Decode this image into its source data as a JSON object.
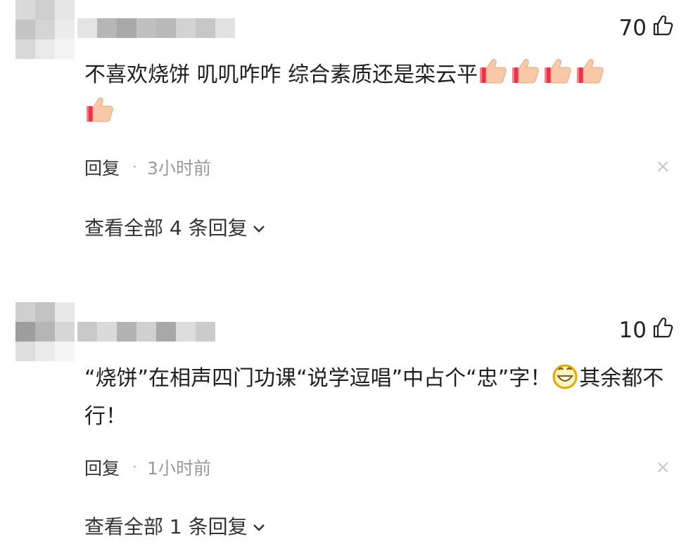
{
  "comments": [
    {
      "likes": "70",
      "text": "不喜欢烧饼 叽叽咋咋 综合素质还是栾云平",
      "thumbs_emoji_count": 5,
      "reply_label": "回复",
      "separator": "·",
      "time": "3小时前",
      "close_symbol": "×",
      "view_replies": "查看全部 4 条回复"
    },
    {
      "likes": "10",
      "text_part1": "“烧饼”在相声四门功课“说学逗唱”中占个“忠”字！",
      "text_part2": "其余都不行！",
      "reply_label": "回复",
      "separator": "·",
      "time": "1小时前",
      "close_symbol": "×",
      "view_replies": "查看全部 1 条回复"
    }
  ],
  "icons": {
    "like": "thumbs-up-outline-icon",
    "emoji_thumb": "thumbs-up-emoji-icon",
    "emoji_laugh": "grinning-face-emoji-icon",
    "chevron": "chevron-down-icon"
  },
  "colors": {
    "text": "#1f1f1f",
    "muted": "#9a9a9a",
    "close": "#c8c8c8"
  }
}
